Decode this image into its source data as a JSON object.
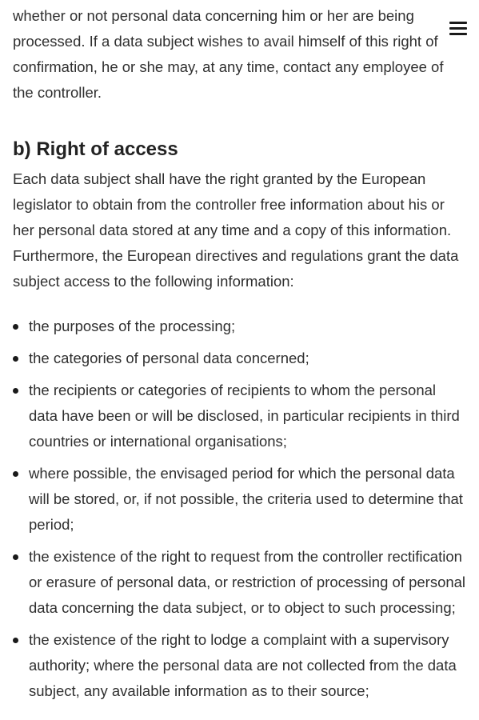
{
  "intro_paragraph": "whether or not personal data concerning him or her are being processed. If a data subject wishes to avail himself of this right of confirmation, he or she may, at any time, contact any employee of the controller.",
  "section": {
    "heading": "b) Right of access",
    "paragraph": "Each data subject shall have the right granted by the European legislator to obtain from the controller free information about his or her personal data stored at any time and a copy of this information. Furthermore, the European directives and regulations grant the data subject access to the following information:",
    "items": [
      "the purposes of the processing;",
      "the categories of personal data concerned;",
      "the recipients or categories of recipients to whom the personal data have been or will be disclosed, in particular recipients in third countries or international organisations;",
      "where possible, the envisaged period for which the personal data will be stored, or, if not possible, the criteria used to determine that period;",
      "the existence of the right to request from the controller rectification or erasure of personal data, or restriction of processing of personal data concerning the data subject, or to object to such processing;",
      "the existence of the right to lodge a complaint with a supervisory authority; where the personal data are not collected from the data subject, any available information as to their source;"
    ]
  },
  "menu_icon": "hamburger-menu-icon"
}
